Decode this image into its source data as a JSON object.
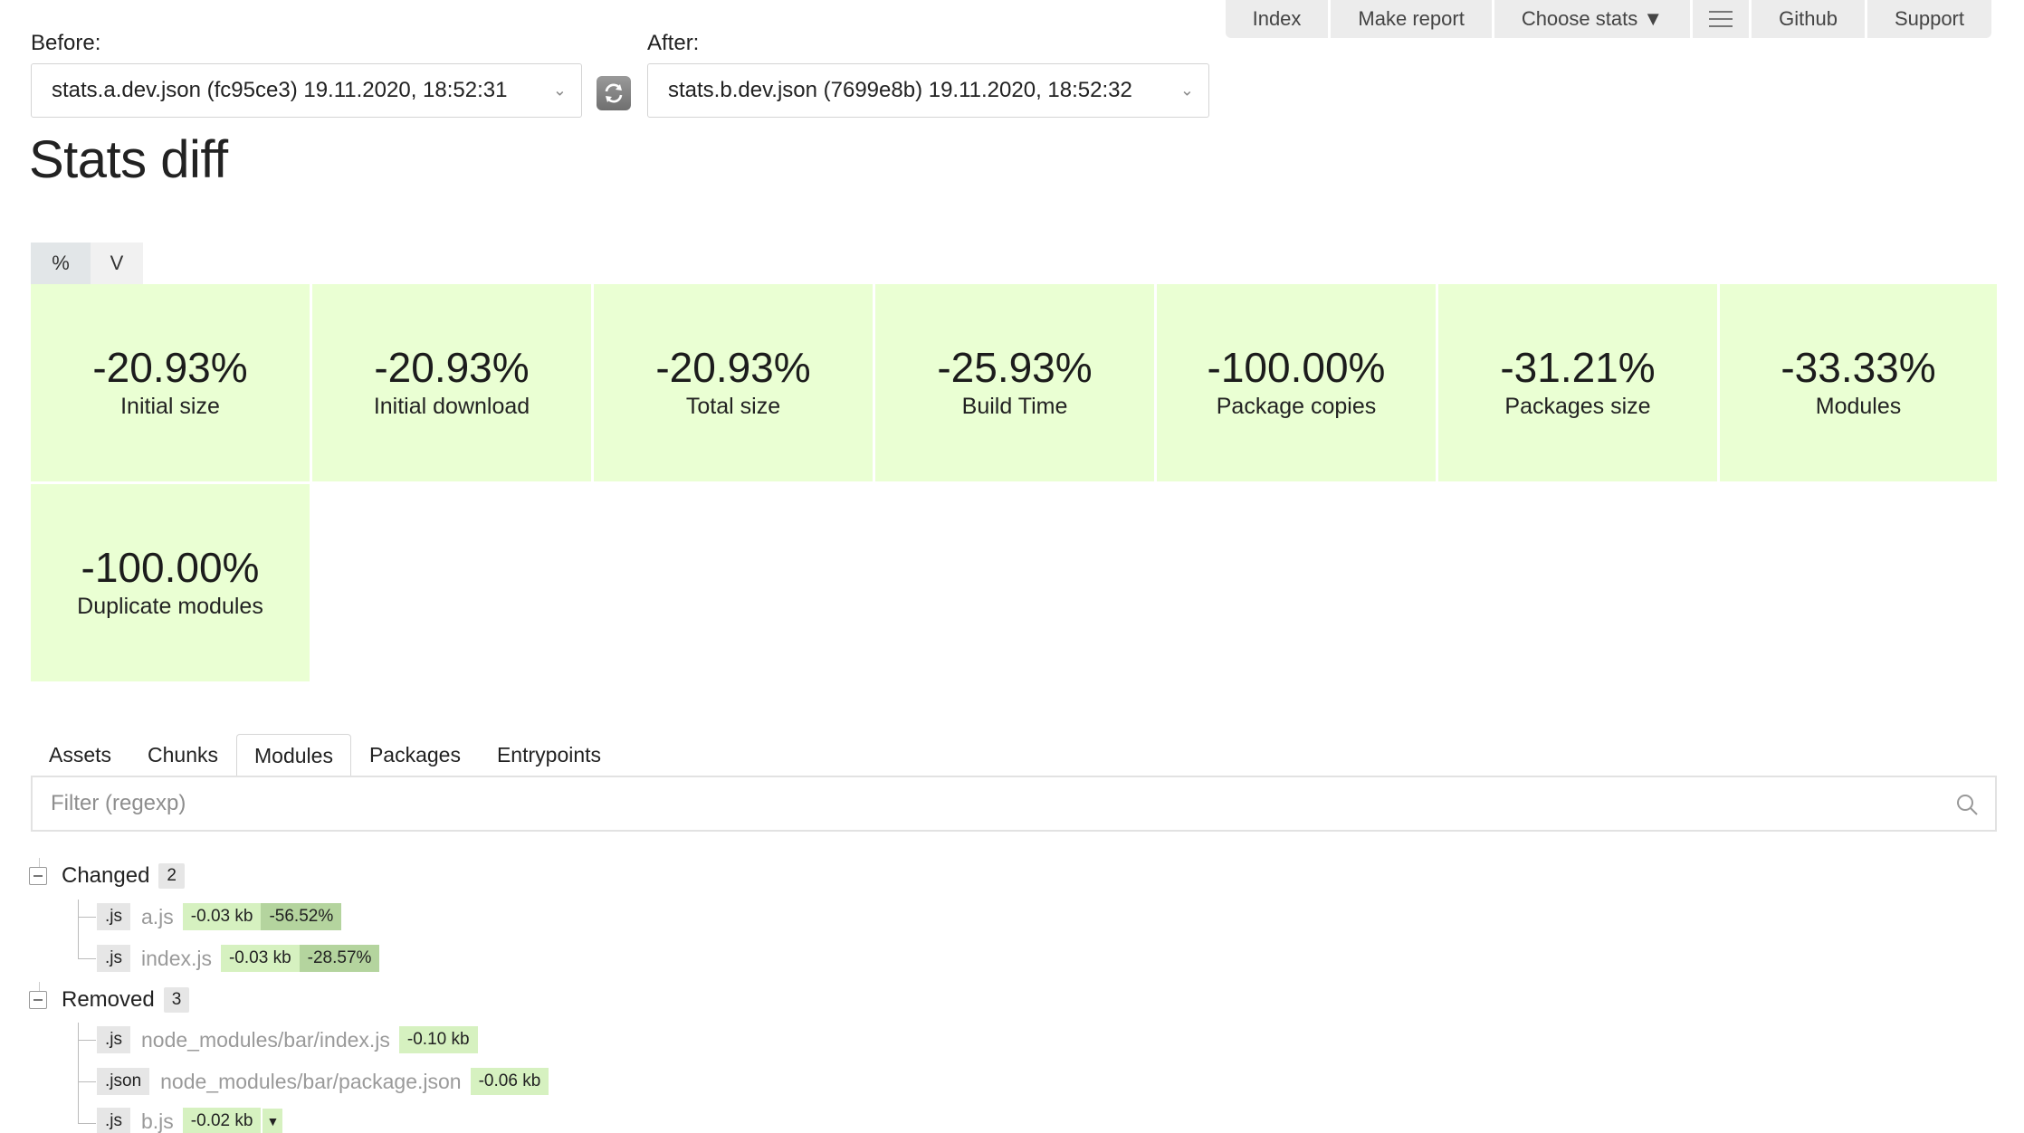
{
  "nav": {
    "items": [
      "Index",
      "Make report",
      "Choose stats ▼",
      "",
      "Github",
      "Support"
    ]
  },
  "before": {
    "label": "Before:",
    "value": "stats.a.dev.json (fc95ce3) 19.11.2020, 18:52:31"
  },
  "after": {
    "label": "After:",
    "value": "stats.b.dev.json (7699e8b) 19.11.2020, 18:52:32"
  },
  "title": "Stats diff",
  "toggle": {
    "percent": "%",
    "value": "V",
    "active": "%"
  },
  "metrics": [
    {
      "value": "-20.93%",
      "label": "Initial size"
    },
    {
      "value": "-20.93%",
      "label": "Initial download"
    },
    {
      "value": "-20.93%",
      "label": "Total size"
    },
    {
      "value": "-25.93%",
      "label": "Build Time"
    },
    {
      "value": "-100.00%",
      "label": "Package copies"
    },
    {
      "value": "-31.21%",
      "label": "Packages size"
    },
    {
      "value": "-33.33%",
      "label": "Modules"
    },
    {
      "value": "-100.00%",
      "label": "Duplicate modules"
    }
  ],
  "tabs": [
    "Assets",
    "Chunks",
    "Modules",
    "Packages",
    "Entrypoints"
  ],
  "active_tab": "Modules",
  "filter": {
    "placeholder": "Filter (regexp)"
  },
  "groups": {
    "changed": {
      "title": "Changed",
      "count": "2",
      "items": [
        {
          "ext": ".js",
          "name": "a.js",
          "size": "-0.03 kb",
          "pct": "-56.52%"
        },
        {
          "ext": ".js",
          "name": "index.js",
          "size": "-0.03 kb",
          "pct": "-28.57%"
        }
      ]
    },
    "removed": {
      "title": "Removed",
      "count": "3",
      "items": [
        {
          "ext": ".js",
          "name": "node_modules/bar/index.js",
          "size": "-0.10 kb"
        },
        {
          "ext": ".json",
          "name": "node_modules/bar/package.json",
          "size": "-0.06 kb"
        },
        {
          "ext": ".js",
          "name": "b.js",
          "size": "-0.02 kb"
        }
      ]
    }
  },
  "colors": {
    "metric_bg": "#eaffd3",
    "size_badge": "#d6f1c0",
    "pct_badge": "#b4d49e"
  }
}
